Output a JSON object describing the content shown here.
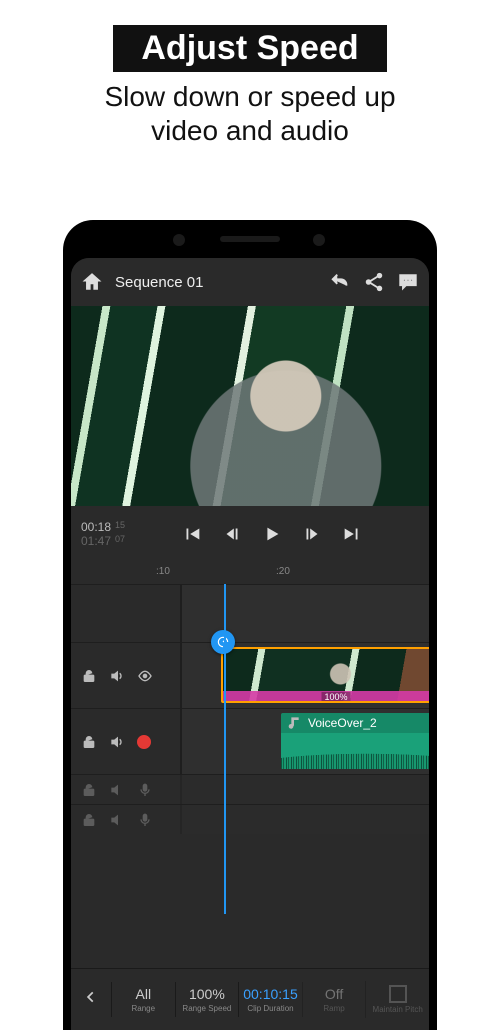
{
  "promo": {
    "title": "Adjust Speed",
    "subtitle_1": "Slow down or speed up",
    "subtitle_2": "video and audio"
  },
  "topbar": {
    "title": "Sequence 01"
  },
  "transport": {
    "current": "00:18",
    "current_frames": "15",
    "total": "01:47",
    "total_frames": "07"
  },
  "ruler": {
    "mark_a": ":10",
    "mark_b": ":20"
  },
  "video_clip": {
    "speed_label": "100%"
  },
  "audio_clip": {
    "label": "VoiceOver_2"
  },
  "toolrow": {
    "range": {
      "val": "All",
      "lab": "Range"
    },
    "speed": {
      "val": "100%",
      "lab": "Range Speed"
    },
    "duration": {
      "val": "00:10:15",
      "lab": "Clip Duration"
    },
    "ramp": {
      "val": "Off",
      "lab": "Ramp"
    },
    "pitch": {
      "lab": "Maintain Pitch"
    }
  }
}
